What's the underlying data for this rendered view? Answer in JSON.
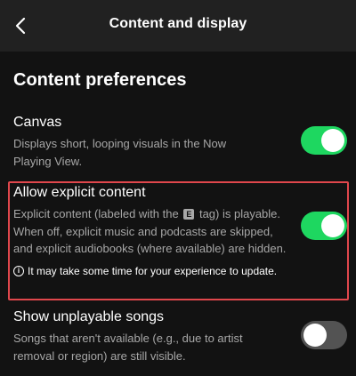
{
  "header": {
    "title": "Content and display"
  },
  "section": {
    "title": "Content preferences"
  },
  "settings": {
    "canvas": {
      "title": "Canvas",
      "desc": "Displays short, looping visuals in the Now Playing View.",
      "enabled": true
    },
    "explicit": {
      "title": "Allow explicit content",
      "desc_part1": "Explicit content (labeled with the",
      "tag": "E",
      "desc_part2": "tag) is playable. When off, explicit music and podcasts are skipped, and explicit audiobooks (where available) are hidden.",
      "info_icon": "i",
      "info": "It may take some time for your experience to update.",
      "enabled": true
    },
    "unplayable": {
      "title": "Show unplayable songs",
      "desc": "Songs that aren't available (e.g., due to artist removal or region) are still visible.",
      "enabled": false
    }
  },
  "colors": {
    "background": "#121212",
    "header": "#212121",
    "accent": "#1ed760",
    "highlight": "#e0474c",
    "secondary_text": "#a7a7a7"
  },
  "icons": {
    "back": "chevron-left-icon",
    "info": "info-circle-icon"
  }
}
